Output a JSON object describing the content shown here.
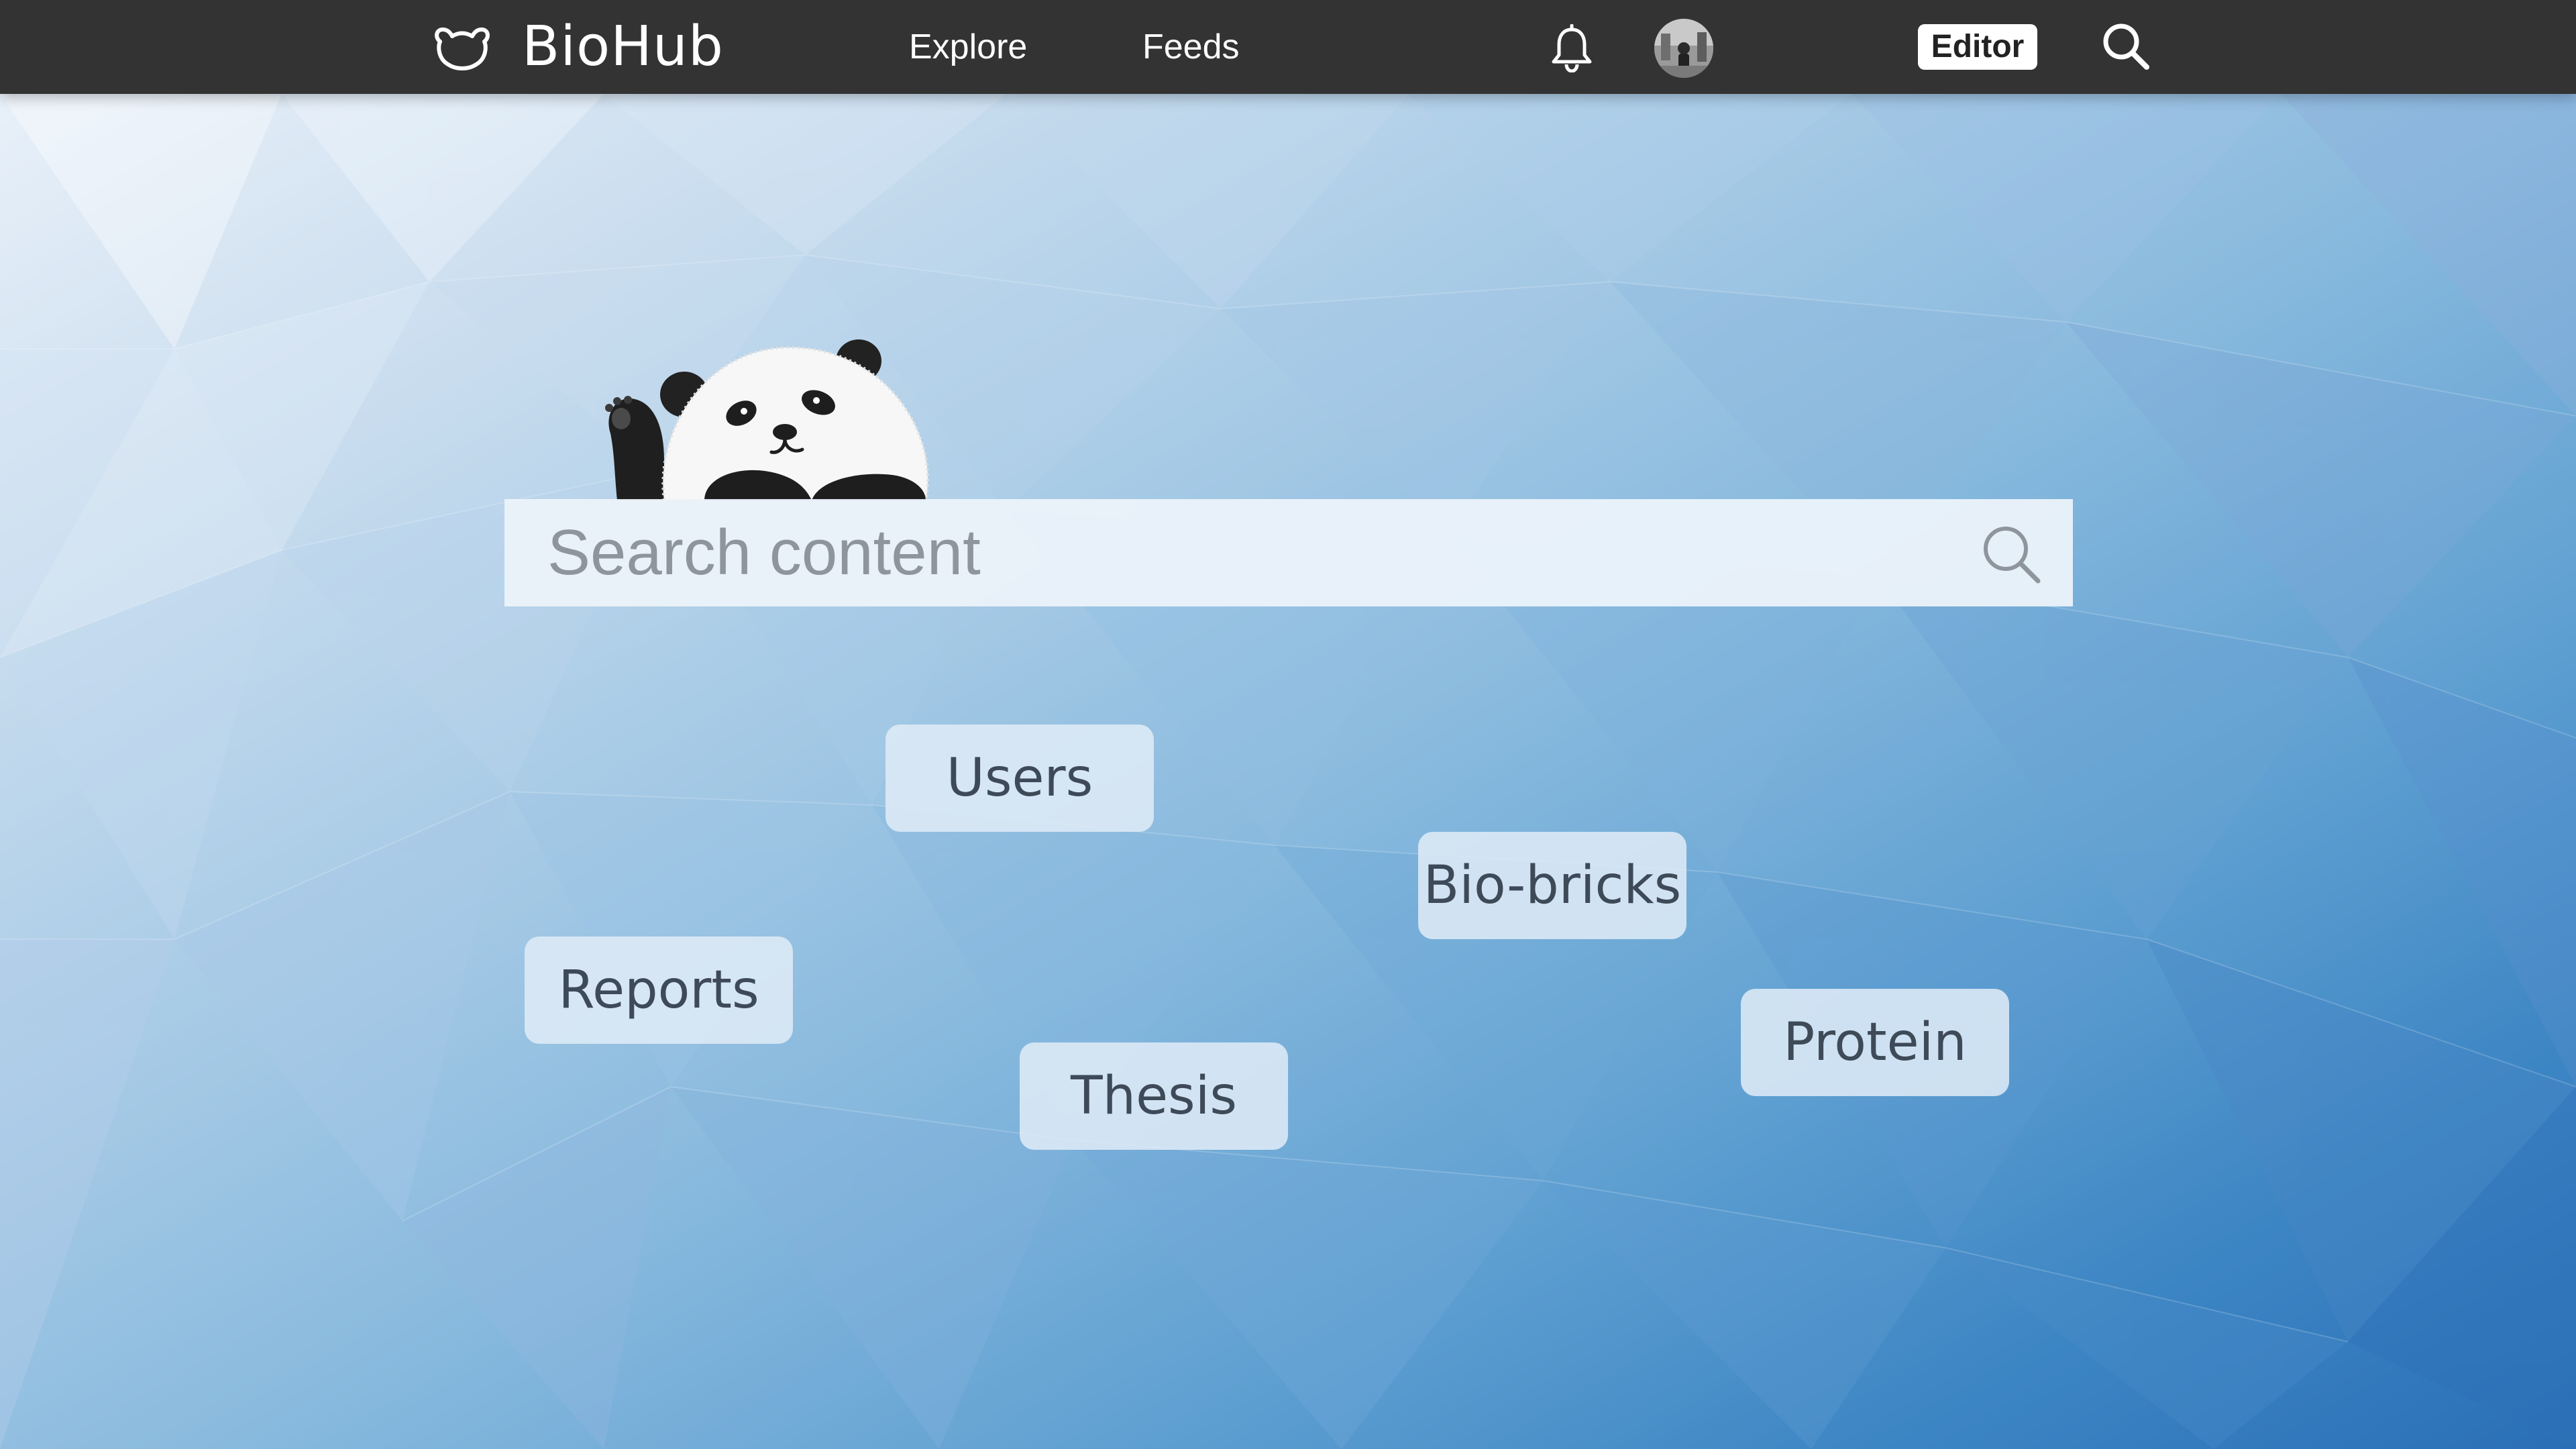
{
  "header": {
    "brand": "BioHub",
    "brand_icon": "bear-head-icon",
    "nav": [
      {
        "label": "Explore"
      },
      {
        "label": "Feeds"
      }
    ],
    "notifications_icon": "bell-icon",
    "avatar_icon": "user-avatar",
    "editor_label": "Editor",
    "search_icon": "search-icon"
  },
  "hero": {
    "mascot": "panda-waving-illustration",
    "search": {
      "placeholder": "Search content",
      "value": ""
    }
  },
  "categories": [
    {
      "label": "Users"
    },
    {
      "label": "Bio-bricks"
    },
    {
      "label": "Reports"
    },
    {
      "label": "Thesis"
    },
    {
      "label": "Protein"
    }
  ],
  "colors": {
    "topbar": "#333333",
    "background_light": "#eef4fb",
    "background_dark": "#2a6fb6",
    "tag_text": "#3e4a57"
  }
}
